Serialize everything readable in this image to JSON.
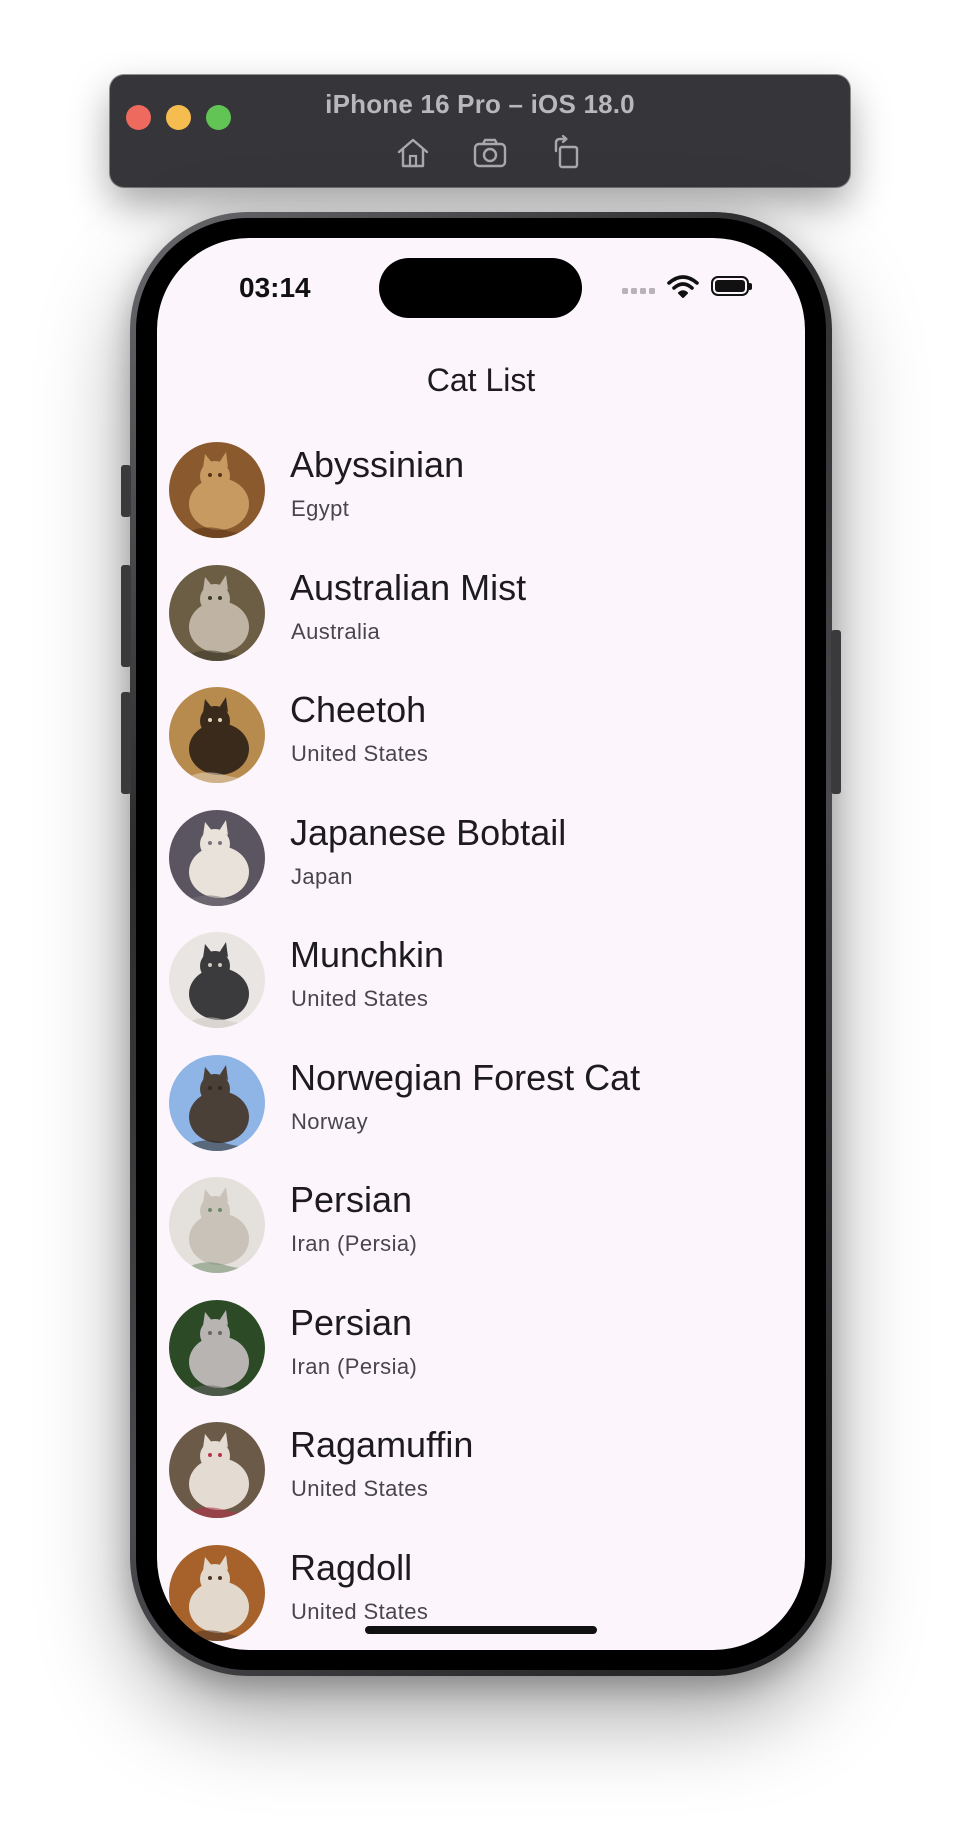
{
  "simulator": {
    "title": "iPhone 16 Pro – iOS 18.0",
    "tools": [
      {
        "name": "home-icon"
      },
      {
        "name": "screenshot-icon"
      },
      {
        "name": "rotate-icon"
      }
    ]
  },
  "status_bar": {
    "time": "03:14"
  },
  "app": {
    "title": "Cat List"
  },
  "cats": [
    {
      "name": "Abyssinian",
      "origin": "Egypt",
      "photo_colors": [
        "#8a5a2e",
        "#c79a62",
        "#5a3418"
      ]
    },
    {
      "name": "Australian Mist",
      "origin": "Australia",
      "photo_colors": [
        "#6b5e44",
        "#bfb3a4",
        "#3e3a2c"
      ]
    },
    {
      "name": "Cheetoh",
      "origin": "United States",
      "photo_colors": [
        "#b78a4e",
        "#3a2a1c",
        "#e3d4bc"
      ]
    },
    {
      "name": "Japanese Bobtail",
      "origin": "Japan",
      "photo_colors": [
        "#5a5560",
        "#e8e2da",
        "#7a747c"
      ]
    },
    {
      "name": "Munchkin",
      "origin": "United States",
      "photo_colors": [
        "#e9e5e2",
        "#3b3a3c",
        "#cfc8c2"
      ]
    },
    {
      "name": "Norwegian Forest Cat",
      "origin": "Norway",
      "photo_colors": [
        "#8fb4e6",
        "#4a4038",
        "#2f2a24"
      ]
    },
    {
      "name": "Persian",
      "origin": "Iran (Persia)",
      "photo_colors": [
        "#e4e1dc",
        "#c8c2b8",
        "#6f8a6a"
      ]
    },
    {
      "name": "Persian",
      "origin": "Iran (Persia)",
      "photo_colors": [
        "#2c4a26",
        "#b8b4b2",
        "#6a6664"
      ]
    },
    {
      "name": "Ragamuffin",
      "origin": "United States",
      "photo_colors": [
        "#6b5a48",
        "#e4dcd2",
        "#b8324a"
      ]
    },
    {
      "name": "Ragdoll",
      "origin": "United States",
      "photo_colors": [
        "#a6622a",
        "#e2d8cc",
        "#4e3626"
      ]
    }
  ]
}
